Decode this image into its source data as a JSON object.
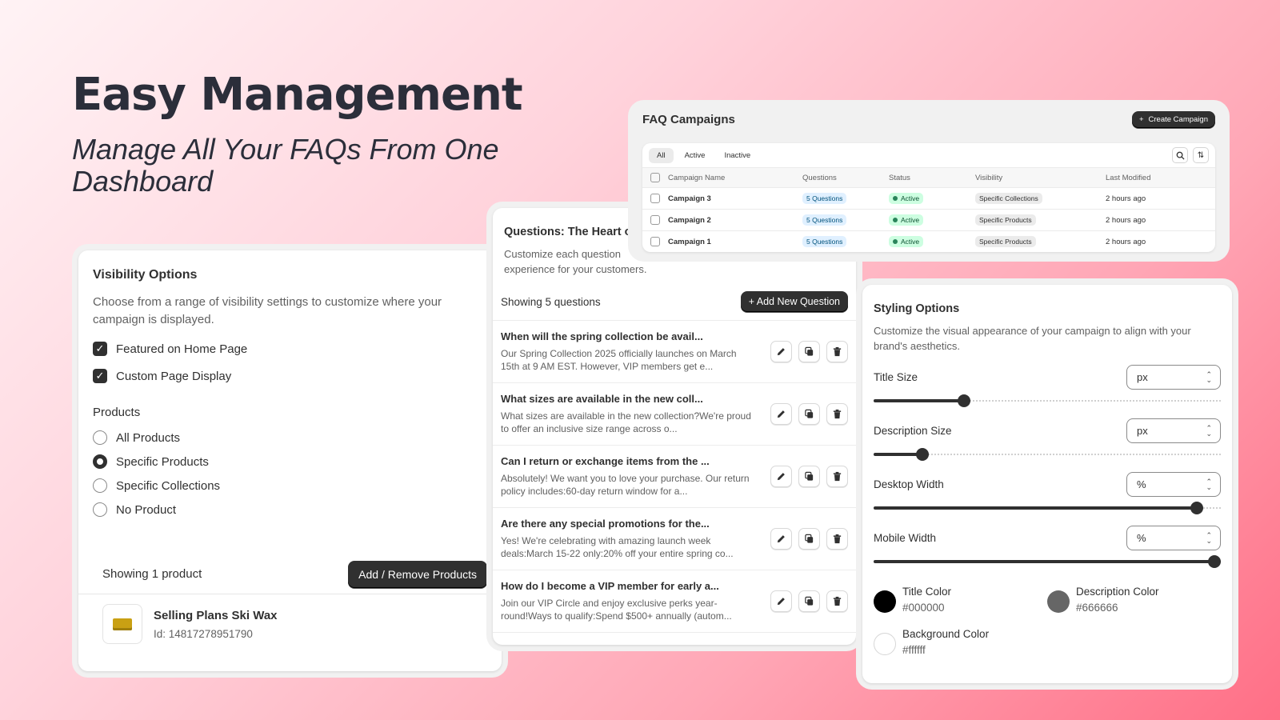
{
  "hero": {
    "title": "Easy Management",
    "subtitle": "Manage All Your FAQs From One Dashboard"
  },
  "visibility": {
    "title": "Visibility Options",
    "description": "Choose from a range of visibility settings to customize where your campaign is displayed.",
    "checkboxes": [
      {
        "label": "Featured on Home Page",
        "checked": true
      },
      {
        "label": "Custom Page Display",
        "checked": true
      }
    ],
    "products_label": "Products",
    "radios": [
      {
        "label": "All Products",
        "selected": false
      },
      {
        "label": "Specific Products",
        "selected": true
      },
      {
        "label": "Specific Collections",
        "selected": false
      },
      {
        "label": "No Product",
        "selected": false
      }
    ],
    "showing_text": "Showing 1 product",
    "add_remove_label": "Add / Remove Products",
    "product": {
      "name": "Selling Plans Ski Wax",
      "id": "Id: 14817278951790"
    }
  },
  "questions": {
    "title": "Questions: The Heart o",
    "description": "Customize each question experience for your customers.",
    "showing_text": "Showing 5 questions",
    "add_label": "+ Add New Question",
    "items": [
      {
        "title": "When will the spring collection be avail...",
        "body": "Our Spring Collection 2025 officially launches on March 15th at 9 AM EST. However, VIP members get e..."
      },
      {
        "title": "What sizes are available in the new coll...",
        "body": "What sizes are available in the new collection?We're proud to offer an inclusive size range across o..."
      },
      {
        "title": "Can I return or exchange items from the ...",
        "body": "Absolutely! We want you to love your purchase. Our return policy includes:60-day return window for a..."
      },
      {
        "title": "Are there any special promotions for the...",
        "body": "Yes! We're celebrating with amazing launch week deals:March 15-22 only:20% off your entire spring co..."
      },
      {
        "title": "How do I become a VIP member for early a...",
        "body": "Join our VIP Circle and enjoy exclusive perks year-round!Ways to qualify:Spend $500+ annually (autom..."
      }
    ]
  },
  "campaigns": {
    "title": "FAQ Campaigns",
    "create_label": "Create Campaign",
    "tabs": [
      "All",
      "Active",
      "Inactive"
    ],
    "columns": [
      "Campaign Name",
      "Questions",
      "Status",
      "Visibility",
      "Last Modified"
    ],
    "rows": [
      {
        "name": "Campaign 3",
        "questions": "5 Questions",
        "status": "Active",
        "visibility": "Specific Collections",
        "modified": "2 hours ago"
      },
      {
        "name": "Campaign 2",
        "questions": "5 Questions",
        "status": "Active",
        "visibility": "Specific Products",
        "modified": "2 hours ago"
      },
      {
        "name": "Campaign 1",
        "questions": "5 Questions",
        "status": "Active",
        "visibility": "Specific Products",
        "modified": "2 hours ago"
      }
    ]
  },
  "styling": {
    "title": "Styling Options",
    "description": "Customize the visual appearance of your campaign to align with your brand's aesthetics.",
    "controls": [
      {
        "label": "Title Size",
        "unit": "px",
        "value_fraction": 0.26
      },
      {
        "label": "Description Size",
        "unit": "px",
        "value_fraction": 0.14
      },
      {
        "label": "Desktop Width",
        "unit": "%",
        "value_fraction": 0.93
      },
      {
        "label": "Mobile Width",
        "unit": "%",
        "value_fraction": 1.0
      }
    ],
    "colors": [
      {
        "name": "Title Color",
        "hex": "#000000"
      },
      {
        "name": "Description Color",
        "hex": "#666666"
      },
      {
        "name": "Background Color",
        "hex": "#ffffff"
      }
    ]
  }
}
